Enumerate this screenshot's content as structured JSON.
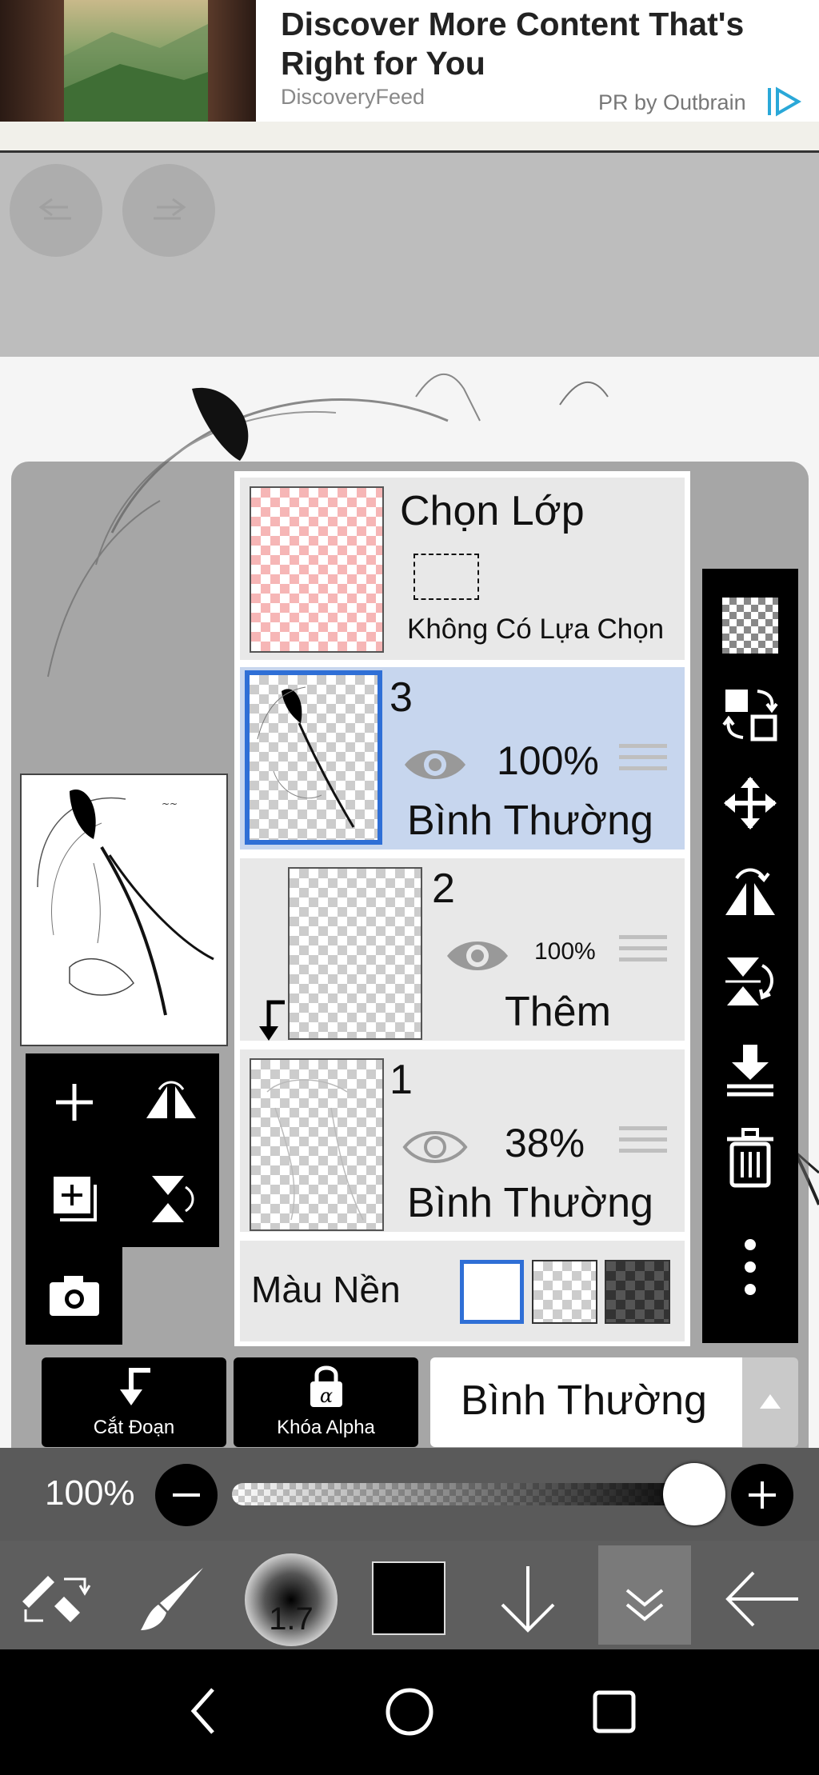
{
  "ad": {
    "title": "Discover More Content That's Right for You",
    "source": "DiscoveryFeed",
    "sponsor": "PR by Outbrain"
  },
  "layer_panel": {
    "selection": {
      "title": "Chọn Lớp",
      "status": "Không Có Lựa Chọn"
    },
    "layers": [
      {
        "number": "3",
        "opacity": "100%",
        "blend": "Bình Thường",
        "selected": true
      },
      {
        "number": "2",
        "opacity": "100%",
        "blend": "Thêm",
        "selected": false
      },
      {
        "number": "1",
        "opacity": "38%",
        "blend": "Bình Thường",
        "selected": false
      }
    ],
    "background": {
      "label": "Màu Nền"
    }
  },
  "bottom": {
    "clip_label": "Cắt Đoạn",
    "alpha_label": "Khóa Alpha",
    "blend_mode": "Bình Thường",
    "opacity": "100%",
    "opacity_level": 1.0
  },
  "toolbar": {
    "brush_size": "1.7",
    "color": "#000000"
  },
  "colors": {
    "accent": "#2f6fd6",
    "selected_row": "#c7d6ee"
  }
}
